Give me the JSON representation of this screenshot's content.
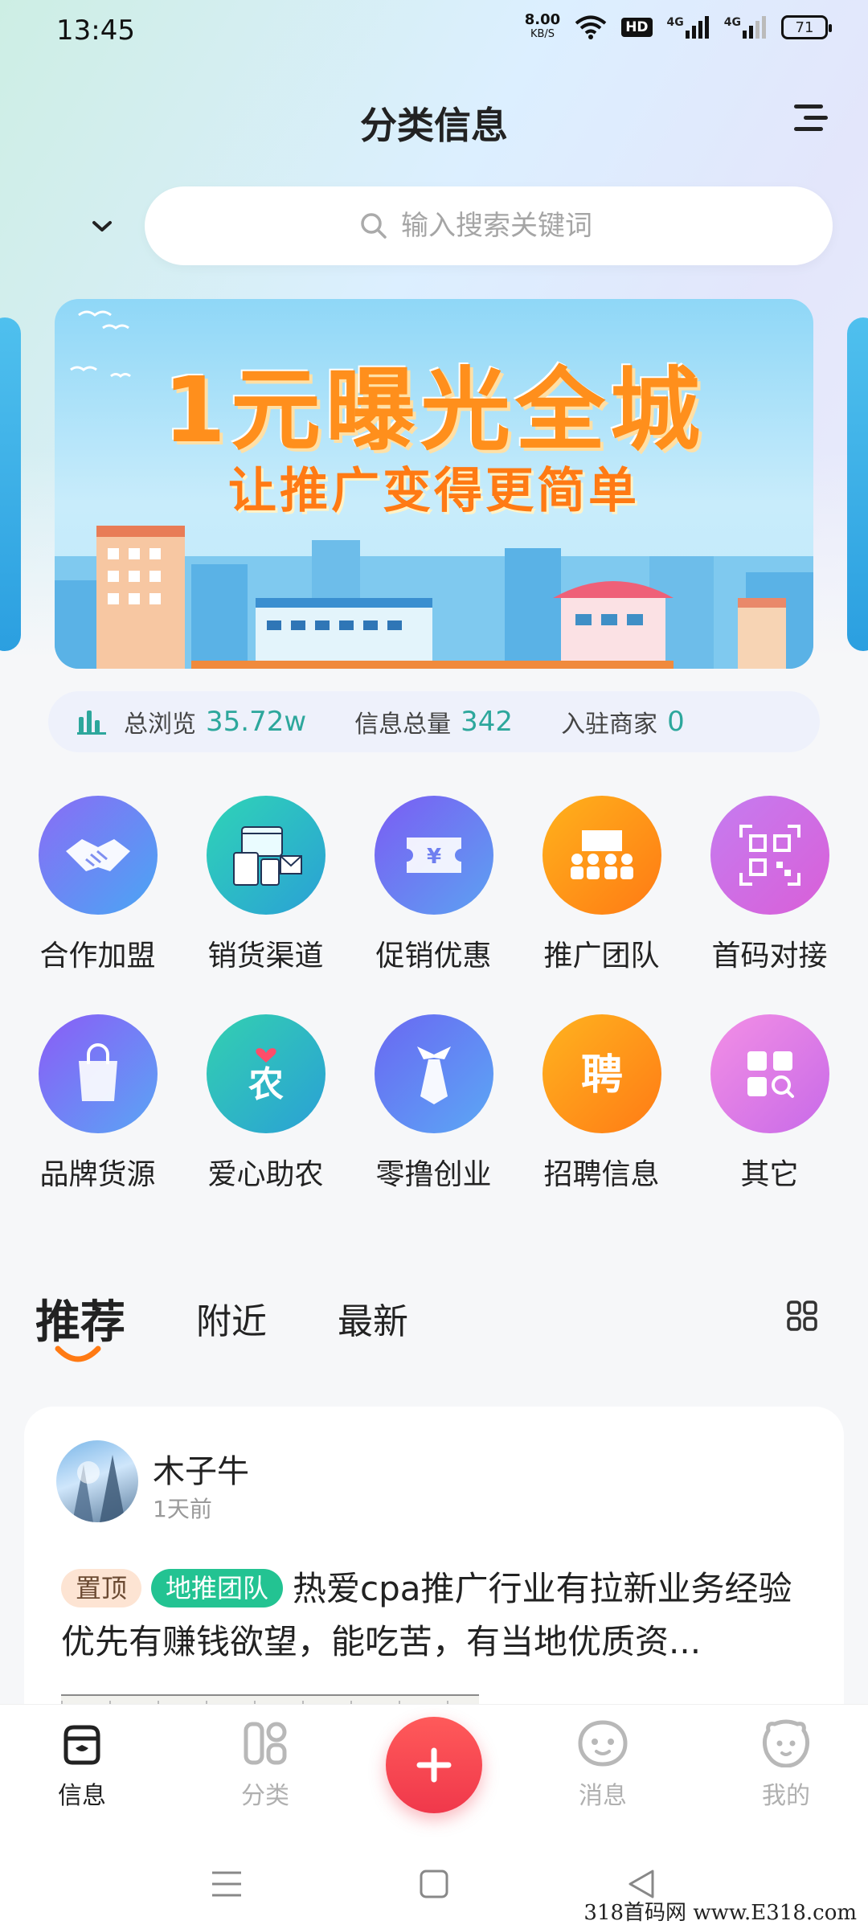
{
  "status_bar": {
    "time": "13:45",
    "net_speed_value": "8.00",
    "net_speed_unit": "KB/S",
    "hd_label": "HD",
    "signal1_label": "4G",
    "signal2_label": "4G",
    "battery_level": "71"
  },
  "header": {
    "title": "分类信息"
  },
  "search": {
    "placeholder": "输入搜索关键词"
  },
  "banner": {
    "title": "1元曝光全城",
    "subtitle": "让推广变得更简单"
  },
  "stats": {
    "views_label": "总浏览",
    "views_value": "35.72w",
    "info_label": "信息总量",
    "info_value": "342",
    "merchants_label": "入驻商家",
    "merchants_value": "0"
  },
  "categories": [
    {
      "label": "合作加盟",
      "icon": "handshake-icon",
      "color_from": "#8a6cf5",
      "color_to": "#4aa6f4"
    },
    {
      "label": "销货渠道",
      "icon": "store-icon",
      "color_from": "#2fd4b6",
      "color_to": "#2aa0d6"
    },
    {
      "label": "促销优惠",
      "icon": "coupon-icon",
      "color_from": "#7b5cf3",
      "color_to": "#5ca2f2"
    },
    {
      "label": "推广团队",
      "icon": "team-icon",
      "color_from": "#ffb21c",
      "color_to": "#ff7a14"
    },
    {
      "label": "首码对接",
      "icon": "qrcode-icon",
      "color_from": "#c57cf0",
      "color_to": "#d95fd8"
    },
    {
      "label": "品牌货源",
      "icon": "shopping-bag-icon",
      "color_from": "#8b5cf6",
      "color_to": "#5aa5f5"
    },
    {
      "label": "爱心助农",
      "icon": "agriculture-icon",
      "color_from": "#33d0b0",
      "color_to": "#2aa0d6"
    },
    {
      "label": "零撸创业",
      "icon": "tie-icon",
      "color_from": "#6a67f2",
      "color_to": "#5ba8f5"
    },
    {
      "label": "招聘信息",
      "icon": "recruit-icon",
      "color_from": "#ffb31f",
      "color_to": "#ff7b15"
    },
    {
      "label": "其它",
      "icon": "grid-search-icon",
      "color_from": "#f38fe5",
      "color_to": "#c86ae8"
    }
  ],
  "tabs": [
    {
      "label": "推荐"
    },
    {
      "label": "附近"
    },
    {
      "label": "最新"
    }
  ],
  "post": {
    "author": "木子牛",
    "time": "1天前",
    "badge_top": "置顶",
    "badge_team": "地推团队",
    "text": "热爱cpa推广行业有拉新业务经验优先有赚钱欲望，能吃苦，有当地优质资..."
  },
  "bottom_nav": [
    {
      "label": "信息",
      "icon": "info-bag-icon",
      "active": true
    },
    {
      "label": "分类",
      "icon": "category-icon",
      "active": false
    },
    {
      "label": "消息",
      "icon": "message-icon",
      "active": false
    },
    {
      "label": "我的",
      "icon": "profile-icon",
      "active": false
    }
  ],
  "watermark": "318首码网 www.E318.com",
  "colors": {
    "accent_green": "#2da79c",
    "fab_red": "#f0384b",
    "banner_orange": "#ff8f1c",
    "tab_underline": "#ff7a14"
  }
}
